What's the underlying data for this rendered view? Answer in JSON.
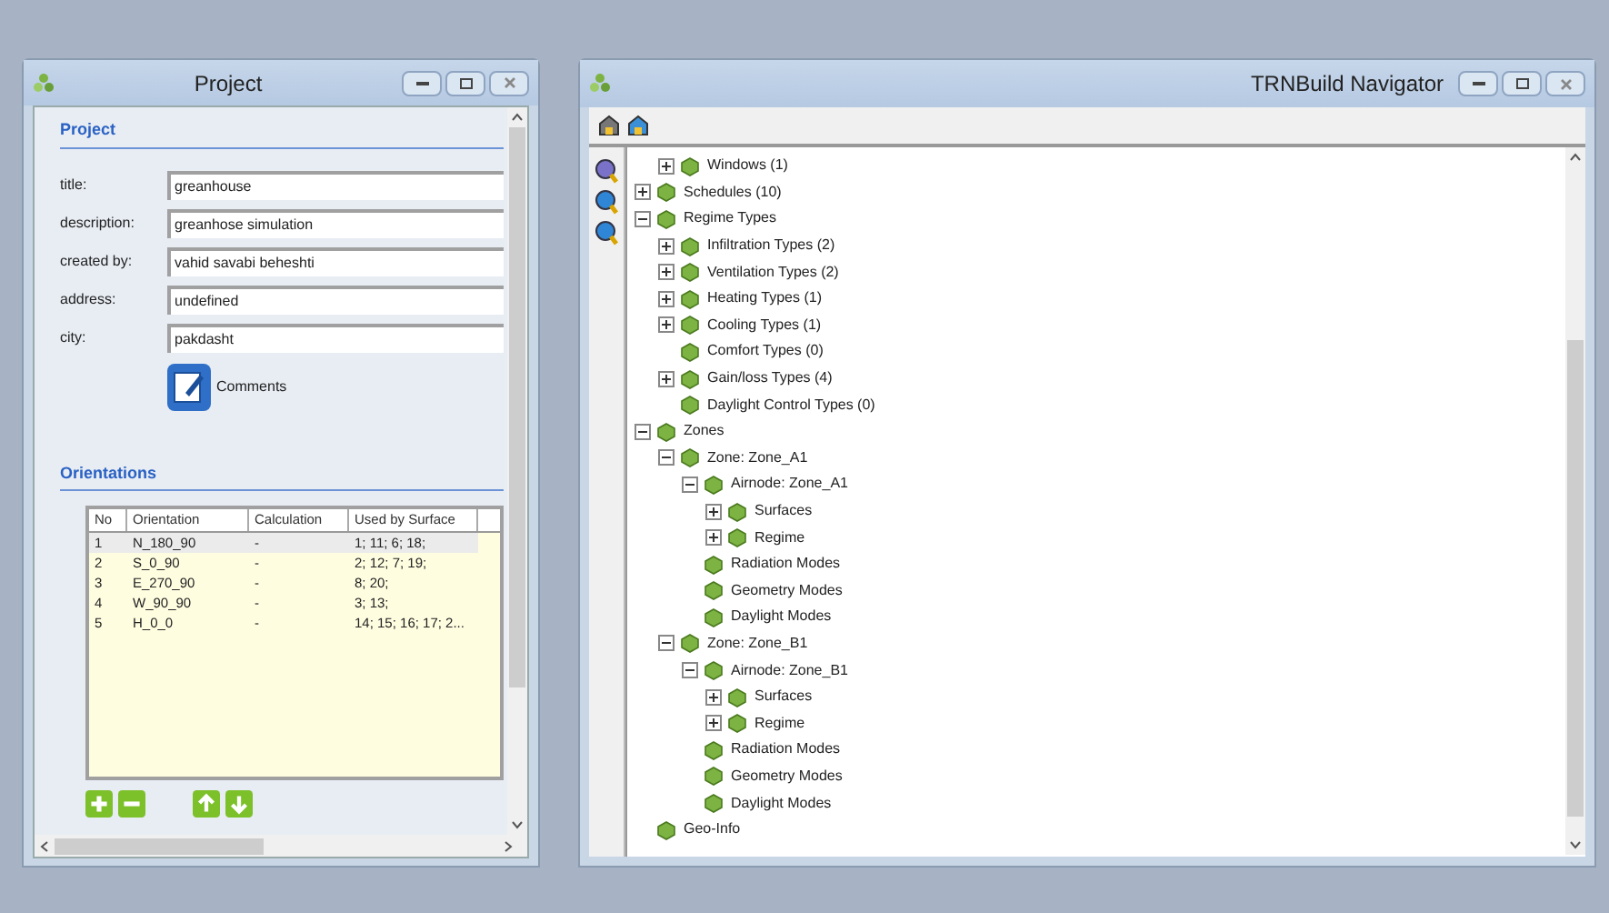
{
  "project_window": {
    "title": "Project",
    "section_title": "Project",
    "fields": [
      {
        "label": "title:",
        "value": "greanhouse"
      },
      {
        "label": "description:",
        "value": "greanhose simulation"
      },
      {
        "label": "created by:",
        "value": "vahid savabi beheshti"
      },
      {
        "label": "address:",
        "value": "undefined"
      },
      {
        "label": "city:",
        "value": "pakdasht"
      }
    ],
    "comments_button": "Comments",
    "orientations_title": "Orientations",
    "table": {
      "columns": [
        "No",
        "Orientation",
        "Calculation",
        "Used by Surface"
      ],
      "rows": [
        {
          "cells": [
            "1",
            "N_180_90",
            "-",
            "1; 11; 6; 18;"
          ],
          "selected": true
        },
        {
          "cells": [
            "2",
            "S_0_90",
            "-",
            "2; 12; 7; 19;"
          ],
          "selected": false
        },
        {
          "cells": [
            "3",
            "E_270_90",
            "-",
            "8; 20;"
          ],
          "selected": false
        },
        {
          "cells": [
            "4",
            "W_90_90",
            "-",
            "3; 13;"
          ],
          "selected": false
        },
        {
          "cells": [
            "5",
            "H_0_0",
            "-",
            "14; 15; 16; 17; 2..."
          ],
          "selected": false
        }
      ]
    }
  },
  "navigator_window": {
    "title": "TRNBuild Navigator",
    "tree": {
      "continued_children": [
        {
          "label": "Windows (1)",
          "expanded": false
        }
      ],
      "items": [
        {
          "label": "Schedules (10)",
          "expanded": false
        },
        {
          "label": "Regime Types",
          "expanded": true,
          "children": [
            {
              "label": "Infiltration Types (2)",
              "expanded": false
            },
            {
              "label": "Ventilation Types (2)",
              "expanded": false
            },
            {
              "label": "Heating Types (1)",
              "expanded": false
            },
            {
              "label": "Cooling Types (1)",
              "expanded": false
            },
            {
              "label": "Comfort Types (0)"
            },
            {
              "label": "Gain/loss Types (4)",
              "expanded": false
            },
            {
              "label": "Daylight Control Types (0)"
            }
          ]
        },
        {
          "label": "Zones",
          "expanded": true,
          "children": [
            {
              "label": "Zone: Zone_A1",
              "expanded": true,
              "children": [
                {
                  "label": "Airnode: Zone_A1",
                  "expanded": true,
                  "children": [
                    {
                      "label": "Surfaces",
                      "expanded": false
                    },
                    {
                      "label": "Regime",
                      "expanded": false
                    }
                  ]
                },
                {
                  "label": "Radiation Modes"
                },
                {
                  "label": "Geometry Modes"
                },
                {
                  "label": "Daylight Modes"
                }
              ]
            },
            {
              "label": "Zone: Zone_B1",
              "expanded": true,
              "children": [
                {
                  "label": "Airnode: Zone_B1",
                  "expanded": true,
                  "children": [
                    {
                      "label": "Surfaces",
                      "expanded": false
                    },
                    {
                      "label": "Regime",
                      "expanded": false
                    }
                  ]
                },
                {
                  "label": "Radiation Modes"
                },
                {
                  "label": "Geometry Modes"
                },
                {
                  "label": "Daylight Modes"
                }
              ]
            }
          ]
        },
        {
          "label": "Geo-Info"
        }
      ]
    }
  }
}
